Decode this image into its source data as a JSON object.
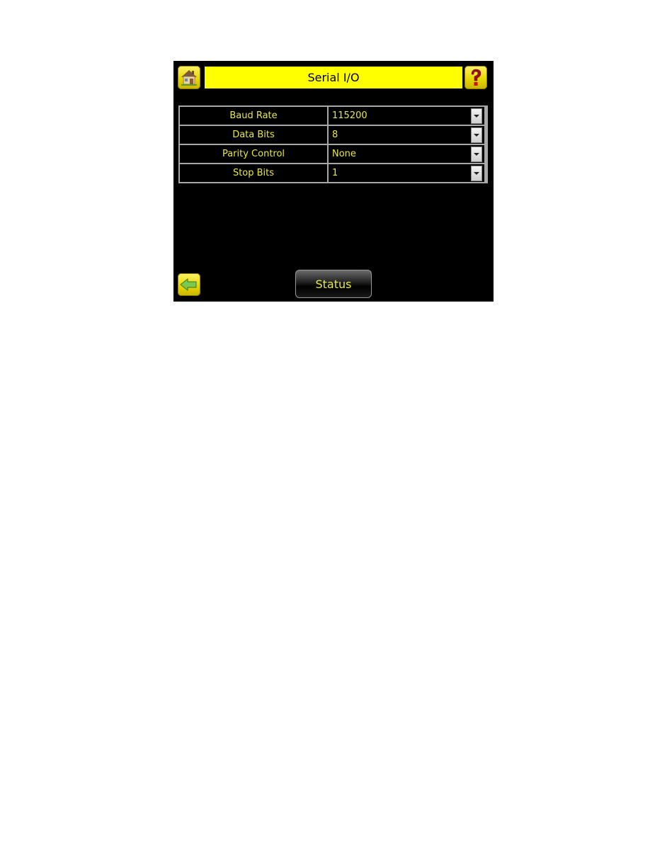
{
  "header": {
    "title": "Serial I/O",
    "home_icon": "home-icon",
    "help_icon": "help-icon"
  },
  "settings": [
    {
      "label": "Baud Rate",
      "value": "115200"
    },
    {
      "label": "Data Bits",
      "value": "8"
    },
    {
      "label": "Parity Control",
      "value": "None"
    },
    {
      "label": "Stop Bits",
      "value": "1"
    }
  ],
  "footer": {
    "back_icon": "back-arrow-icon",
    "status_label": "Status"
  },
  "colors": {
    "title_bar": "#ffff00",
    "text_accent": "#e8e840",
    "background": "#000000"
  }
}
